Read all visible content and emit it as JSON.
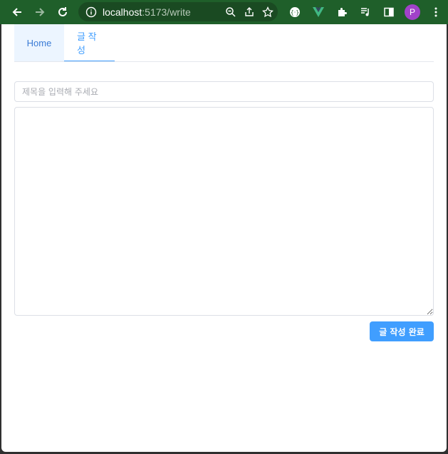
{
  "browser": {
    "url_host": "localhost",
    "url_path": ":5173/write",
    "profile_initial": "P",
    "icons": [
      "back-arrow-icon",
      "forward-arrow-icon",
      "reload-icon",
      "info-icon",
      "zoom-icon",
      "share-icon",
      "bookmark-star-icon",
      "extension-icon",
      "vue-devtools-icon",
      "puzzle-icon",
      "media-queue-icon",
      "side-panel-icon",
      "profile-avatar",
      "kebab-menu-icon"
    ],
    "colors": {
      "toolbar": "#1f5f2a",
      "omnibox": "#1a4a22",
      "profile": "#a142c9"
    }
  },
  "nav": {
    "tabs": [
      {
        "label": "Home"
      },
      {
        "label": "글 작성"
      }
    ],
    "active_index": 1
  },
  "form": {
    "title_placeholder": "제목을 입력해 주세요",
    "title_value": "",
    "content_value": "",
    "submit_label": "글 작성 완료"
  },
  "colors": {
    "accent": "#409eff",
    "border": "#dcdfe6"
  }
}
